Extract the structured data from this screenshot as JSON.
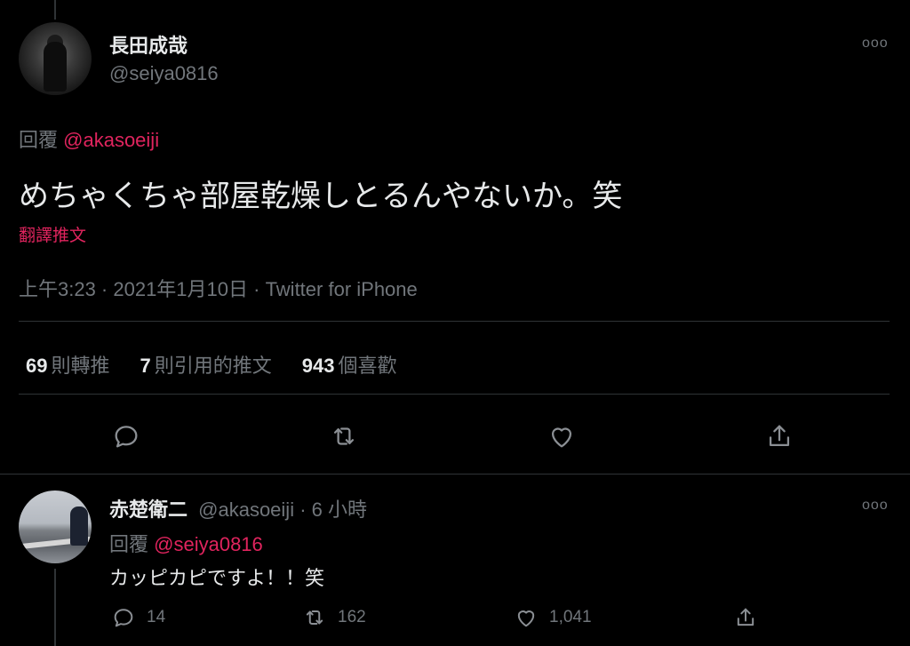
{
  "tweet": {
    "author_name": "長田成哉",
    "author_handle": "@seiya0816",
    "more_label": "ooo",
    "reply_prefix": "回覆",
    "reply_to": "@akasoeiji",
    "text": "めちゃくちゃ部屋乾燥しとるんやないか。笑",
    "translate_label": "翻譯推文",
    "meta": "上午3:23 · 2021年1月10日 · Twitter for iPhone",
    "stats": {
      "retweets_count": "69",
      "retweets_label": "則轉推",
      "quotes_count": "7",
      "quotes_label": "則引用的推文",
      "likes_count": "943",
      "likes_label": "個喜歡"
    },
    "actions": {
      "reply_icon": "comment-icon",
      "retweet_icon": "retweet-icon",
      "like_icon": "heart-icon",
      "share_icon": "share-icon"
    }
  },
  "reply": {
    "author_name": "赤楚衛二",
    "author_handle": "@akasoeiji",
    "time": "· 6 小時",
    "more_label": "ooo",
    "reply_prefix": "回覆",
    "reply_to": "@seiya0816",
    "text": "カッピカピですよ！！笑",
    "reply_count": "14",
    "retweet_count": "162",
    "like_count": "1,041"
  },
  "colors": {
    "background": "#000000",
    "text_primary": "#e7e9ea",
    "text_secondary": "#71767b",
    "accent_link": "#e0245e",
    "divider": "#2f3336"
  }
}
